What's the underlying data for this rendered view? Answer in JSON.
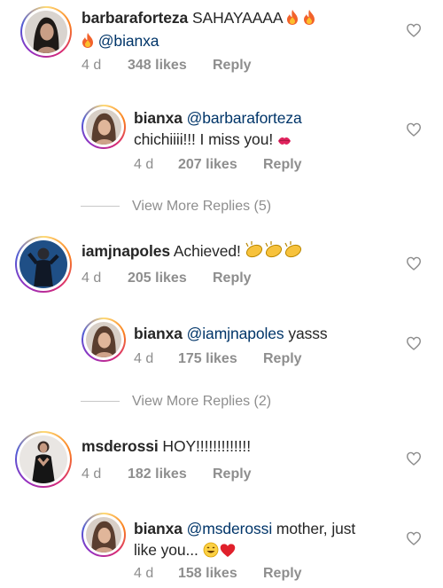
{
  "comments": [
    {
      "username": "barbaraforteza",
      "text_part1": "SAHAYAAAA",
      "mention": "@bianxa",
      "time": "4 d",
      "likes": "348 likes",
      "reply": "Reply",
      "avatar": "woman-portrait-avatar"
    },
    {
      "username": "bianxa",
      "mention": "@barbaraforteza",
      "text_part2": "chichiiii!!! I miss you!",
      "time": "4 d",
      "likes": "207 likes",
      "reply": "Reply",
      "avatar": "woman-portrait-avatar"
    },
    {
      "username": "iamjnapoles",
      "text_part1": "Achieved!",
      "time": "4 d",
      "likes": "205 likes",
      "reply": "Reply",
      "avatar": "man-in-blue-avatar"
    },
    {
      "username": "bianxa",
      "mention": "@iamjnapoles",
      "text_part2": "yasss",
      "time": "4 d",
      "likes": "175 likes",
      "reply": "Reply",
      "avatar": "woman-portrait-avatar"
    },
    {
      "username": "msderossi",
      "text_part1": "HOY!!!!!!!!!!!!!",
      "time": "4 d",
      "likes": "182 likes",
      "reply": "Reply",
      "avatar": "woman-dark-dress-avatar"
    },
    {
      "username": "bianxa",
      "mention": "@msderossi",
      "text_part2": "mother, just",
      "text_part3": "like you...",
      "time": "4 d",
      "likes": "158 likes",
      "reply": "Reply",
      "avatar": "woman-portrait-avatar"
    }
  ],
  "view_more": [
    "View More Replies (5)",
    "View More Replies (2)"
  ],
  "colors": {
    "text": "#262626",
    "muted": "#8e8e8e",
    "mention": "#003569",
    "heart_outline": "#8e8e8e"
  }
}
